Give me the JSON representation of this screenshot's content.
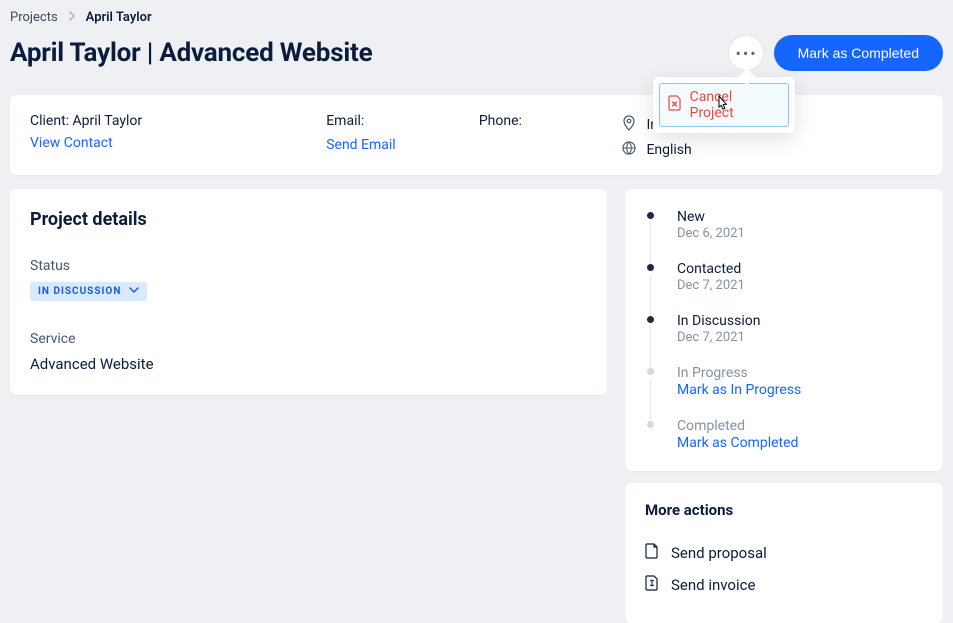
{
  "breadcrumbs": {
    "root": "Projects",
    "current": "April Taylor"
  },
  "header": {
    "title": "April Taylor | Advanced Website",
    "primary_button": "Mark as Completed",
    "dropdown": {
      "cancel_label": "Cancel Project"
    }
  },
  "client": {
    "client_label": "Client:",
    "client_name": "April Taylor",
    "view_contact": "View Contact",
    "email_label": "Email:",
    "phone_label": "Phone:",
    "send_email": "Send Email",
    "country": "Ireland",
    "language": "English"
  },
  "details": {
    "heading": "Project details",
    "status_label": "Status",
    "status_value": "IN DISCUSSION",
    "service_label": "Service",
    "service_value": "Advanced Website"
  },
  "timeline": [
    {
      "title": "New",
      "sub": "Dec 6, 2021",
      "muted": false,
      "action": ""
    },
    {
      "title": "Contacted",
      "sub": "Dec 7, 2021",
      "muted": false,
      "action": ""
    },
    {
      "title": "In Discussion",
      "sub": "Dec 7, 2021",
      "muted": false,
      "action": ""
    },
    {
      "title": "In Progress",
      "sub": "",
      "muted": true,
      "action": "Mark as In Progress"
    },
    {
      "title": "Completed",
      "sub": "",
      "muted": true,
      "action": "Mark as Completed"
    }
  ],
  "more_actions": {
    "heading": "More actions",
    "send_proposal": "Send proposal",
    "send_invoice": "Send invoice"
  }
}
